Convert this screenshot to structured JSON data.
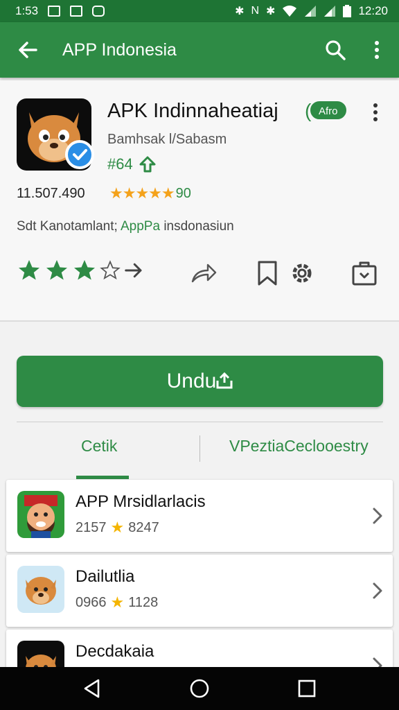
{
  "status_bar": {
    "time_left": "1:53",
    "time_right": "12:20"
  },
  "app_bar": {
    "title": "APP Indonesia",
    "back_icon": "arrow-back-icon",
    "search_icon": "search-icon",
    "more_icon": "more-vert-icon",
    "color": "#2e8b45"
  },
  "app": {
    "name": "APK Indinnaheatiaj",
    "badge": "Afro",
    "developer": "Bamhsak l/Sabasm",
    "rank": "#64",
    "downloads": "11.507.490",
    "rating_stars": "★★★★★",
    "rating_value": "90",
    "tagline_prefix": "Sdt Kanotamlant; ",
    "tagline_highlight": "AppPa",
    "tagline_suffix": " insdonasiun"
  },
  "install_button": {
    "label": "Undu"
  },
  "tabs": [
    {
      "label": "Cetik",
      "active": true
    },
    {
      "label": "VPeztiaCeclooestry",
      "active": false
    }
  ],
  "list": [
    {
      "title": "APP Mrsidlarlacis",
      "count": "2157",
      "value": "8247"
    },
    {
      "title": "Dailutlia",
      "count": "0966",
      "value": "1128"
    },
    {
      "title": "Decdakaia",
      "count": "",
      "value": ""
    }
  ],
  "colors": {
    "accent": "#2e8b45",
    "star": "#f4a21b",
    "verified": "#2a8ee6"
  }
}
